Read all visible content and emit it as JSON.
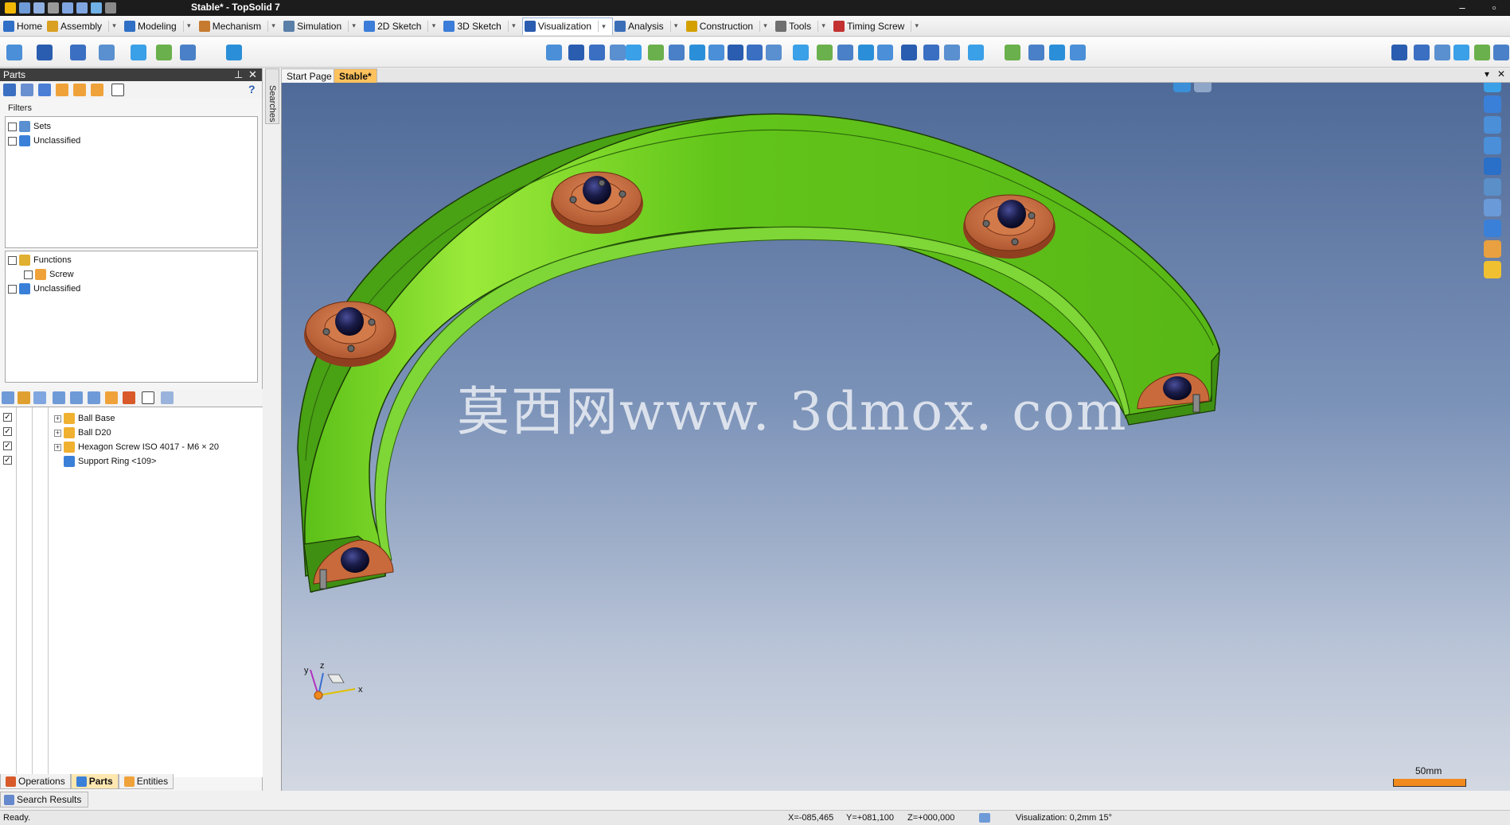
{
  "app": {
    "title": "Stable* - TopSolid 7"
  },
  "menu": {
    "tabs": [
      {
        "label": "Home",
        "color": "#2f6fc6"
      },
      {
        "label": "Assembly",
        "color": "#d9a021"
      },
      {
        "label": "Modeling",
        "color": "#2f6fc6"
      },
      {
        "label": "Mechanism",
        "color": "#c67a2f"
      },
      {
        "label": "Simulation",
        "color": "#5a7fa8"
      },
      {
        "label": "2D Sketch",
        "color": "#3b7dd8"
      },
      {
        "label": "3D Sketch",
        "color": "#3b7dd8"
      },
      {
        "label": "Visualization",
        "color": "#2a5db0"
      },
      {
        "label": "Analysis",
        "color": "#3a6fb8"
      },
      {
        "label": "Construction",
        "color": "#d4a000"
      },
      {
        "label": "Tools",
        "color": "#6f6f6f"
      },
      {
        "label": "Timing Screw",
        "color": "#c23030"
      }
    ]
  },
  "parts_panel": {
    "title": "Parts",
    "help_glyph": "?",
    "filters_label": "Filters",
    "filter_group_1": [
      {
        "label": "Sets"
      },
      {
        "label": "Unclassified"
      }
    ],
    "filter_group_2": [
      {
        "label": "Functions"
      },
      {
        "label": "Screw"
      },
      {
        "label": "Unclassified"
      }
    ],
    "parts": [
      {
        "label": "Ball Base",
        "checked": true
      },
      {
        "label": "Ball D20",
        "checked": true
      },
      {
        "label": "Hexagon Screw ISO 4017 - M6 × 20",
        "checked": true
      },
      {
        "label": "Support Ring <109>",
        "checked": true
      }
    ],
    "bottom_tabs": [
      {
        "label": "Operations",
        "active": false
      },
      {
        "label": "Parts",
        "active": true
      },
      {
        "label": "Entities",
        "active": false
      }
    ],
    "search_results": "Search Results",
    "searches_side_tab": "Searches"
  },
  "documents": {
    "tabs": [
      {
        "label": "Start Page",
        "active": false
      },
      {
        "label": "Stable*",
        "active": true
      }
    ]
  },
  "viewport": {
    "watermark": "莫西网www. 3dmox. com",
    "axis_labels": {
      "x": "x",
      "y": "y",
      "z": "z"
    },
    "scale_label": "50mm",
    "colors": {
      "ring": "#5fc41a",
      "ring_dark": "#3f8f12",
      "flange": "#c86a3c",
      "ball": "#15163d",
      "scale": "#f08a1c"
    }
  },
  "status": {
    "ready": "Ready.",
    "x": "X=-085,465",
    "y": "Y=+081,100",
    "z": "Z=+000,000",
    "visualization": "Visualization: 0,2mm 15°"
  }
}
